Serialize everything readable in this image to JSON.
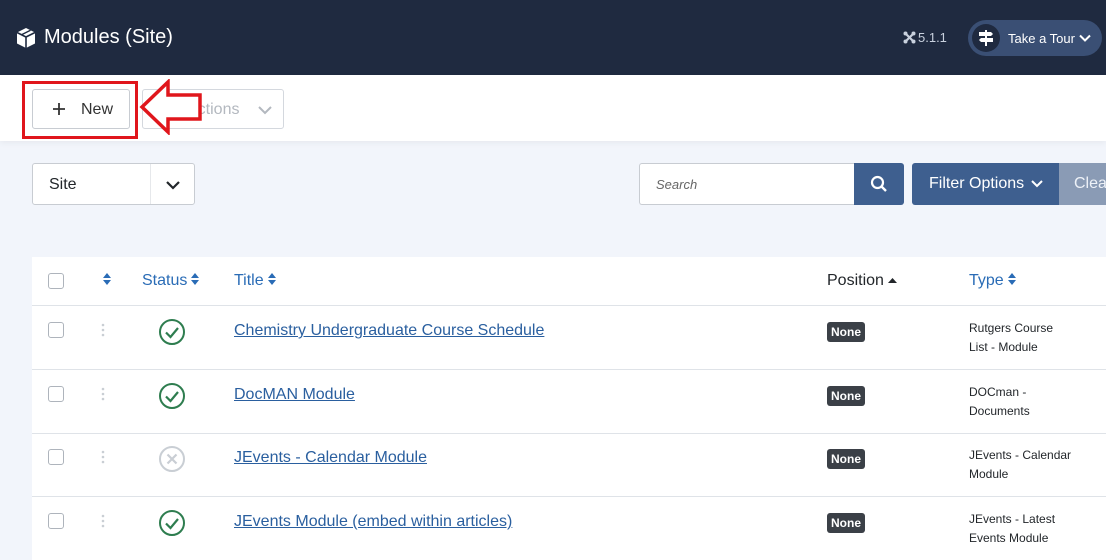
{
  "header": {
    "title": "Modules (Site)",
    "version": "5.1.1",
    "tour_label": "Take a Tour",
    "bg_color": "#1f2a40"
  },
  "toolbar": {
    "new_label": "New",
    "actions_label": "Actions",
    "highlight_color": "#e0161c"
  },
  "filters": {
    "client_value": "Site",
    "search_placeholder": "Search",
    "filter_options_label": "Filter Options",
    "clear_label": "Clear"
  },
  "table": {
    "headers": {
      "status": "Status",
      "title": "Title",
      "position": "Position",
      "type": "Type"
    },
    "rows": [
      {
        "status": "published",
        "title": "Chemistry Undergraduate Course Schedule",
        "position": "None",
        "type_line1": "Rutgers Course",
        "type_line2": "List - Module"
      },
      {
        "status": "published",
        "title": "DocMAN Module",
        "position": "None",
        "type_line1": "DOCman -",
        "type_line2": "Documents"
      },
      {
        "status": "unpublished",
        "title": "JEvents - Calendar Module",
        "position": "None",
        "type_line1": "JEvents - Calendar",
        "type_line2": "Module"
      },
      {
        "status": "published",
        "title": "JEvents Module (embed within articles)",
        "position": "None",
        "type_line1": "JEvents - Latest",
        "type_line2": "Events Module"
      }
    ]
  }
}
